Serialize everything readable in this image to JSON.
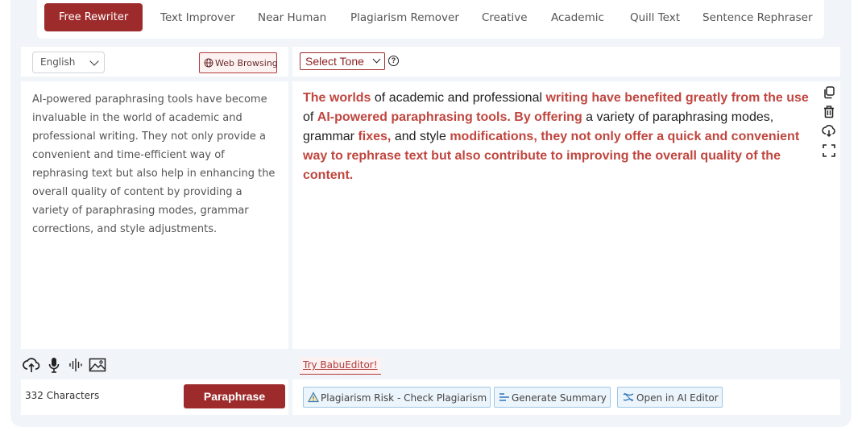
{
  "modes": {
    "items": [
      {
        "label": "Free Rewriter",
        "active": true
      },
      {
        "label": "Text Improver"
      },
      {
        "label": "Near Human"
      },
      {
        "label": "Plagiarism Remover"
      },
      {
        "label": "Creative"
      },
      {
        "label": "Academic"
      },
      {
        "label": "Quill Text"
      },
      {
        "label": "Sentence Rephraser"
      }
    ]
  },
  "input": {
    "language": "English",
    "web_browsing_label": "Web Browsing",
    "text": "AI-powered paraphrasing tools have become invaluable in the world of academic and professional writing. They not only provide a convenient and time-efficient way of rephrasing text but also help in enhancing the overall quality of content by providing a variety of paraphrasing modes, grammar corrections, and style adjustments.",
    "char_count": "332 Characters",
    "paraphrase_label": "Paraphrase",
    "tool_icons": [
      "upload-cloud-icon",
      "microphone-icon",
      "audio-wave-icon",
      "image-icon"
    ]
  },
  "output": {
    "tone_label": "Select Tone",
    "segments": [
      {
        "text": "The worlds",
        "hl": true
      },
      {
        "text": " of academic and professional ",
        "hl": false
      },
      {
        "text": "writing have benefited greatly from the use",
        "hl": true
      },
      {
        "text": " of ",
        "hl": false
      },
      {
        "text": "AI-powered paraphrasing tools. By offering",
        "hl": true
      },
      {
        "text": " a variety of paraphrasing modes, grammar ",
        "hl": false
      },
      {
        "text": "fixes,",
        "hl": true
      },
      {
        "text": " and style ",
        "hl": false
      },
      {
        "text": "modifications, they not only offer a quick and convenient way to rephrase text but also contribute to improving the overall quality of the content.",
        "hl": true
      }
    ],
    "side_icons": [
      "copy-icon",
      "trash-icon",
      "download-icon",
      "fullscreen-icon"
    ],
    "try_label": "Try BabuEditor!",
    "actions": [
      {
        "label": "Plagiarism Risk - Check Plagiarism",
        "icon": "warning-icon"
      },
      {
        "label": "Generate Summary",
        "icon": "summary-icon"
      },
      {
        "label": "Open in AI Editor",
        "icon": "editor-icon"
      }
    ]
  },
  "colors": {
    "brand": "#9e2b2b",
    "highlight": "#c0463f",
    "action_border": "#9cc7e8"
  }
}
